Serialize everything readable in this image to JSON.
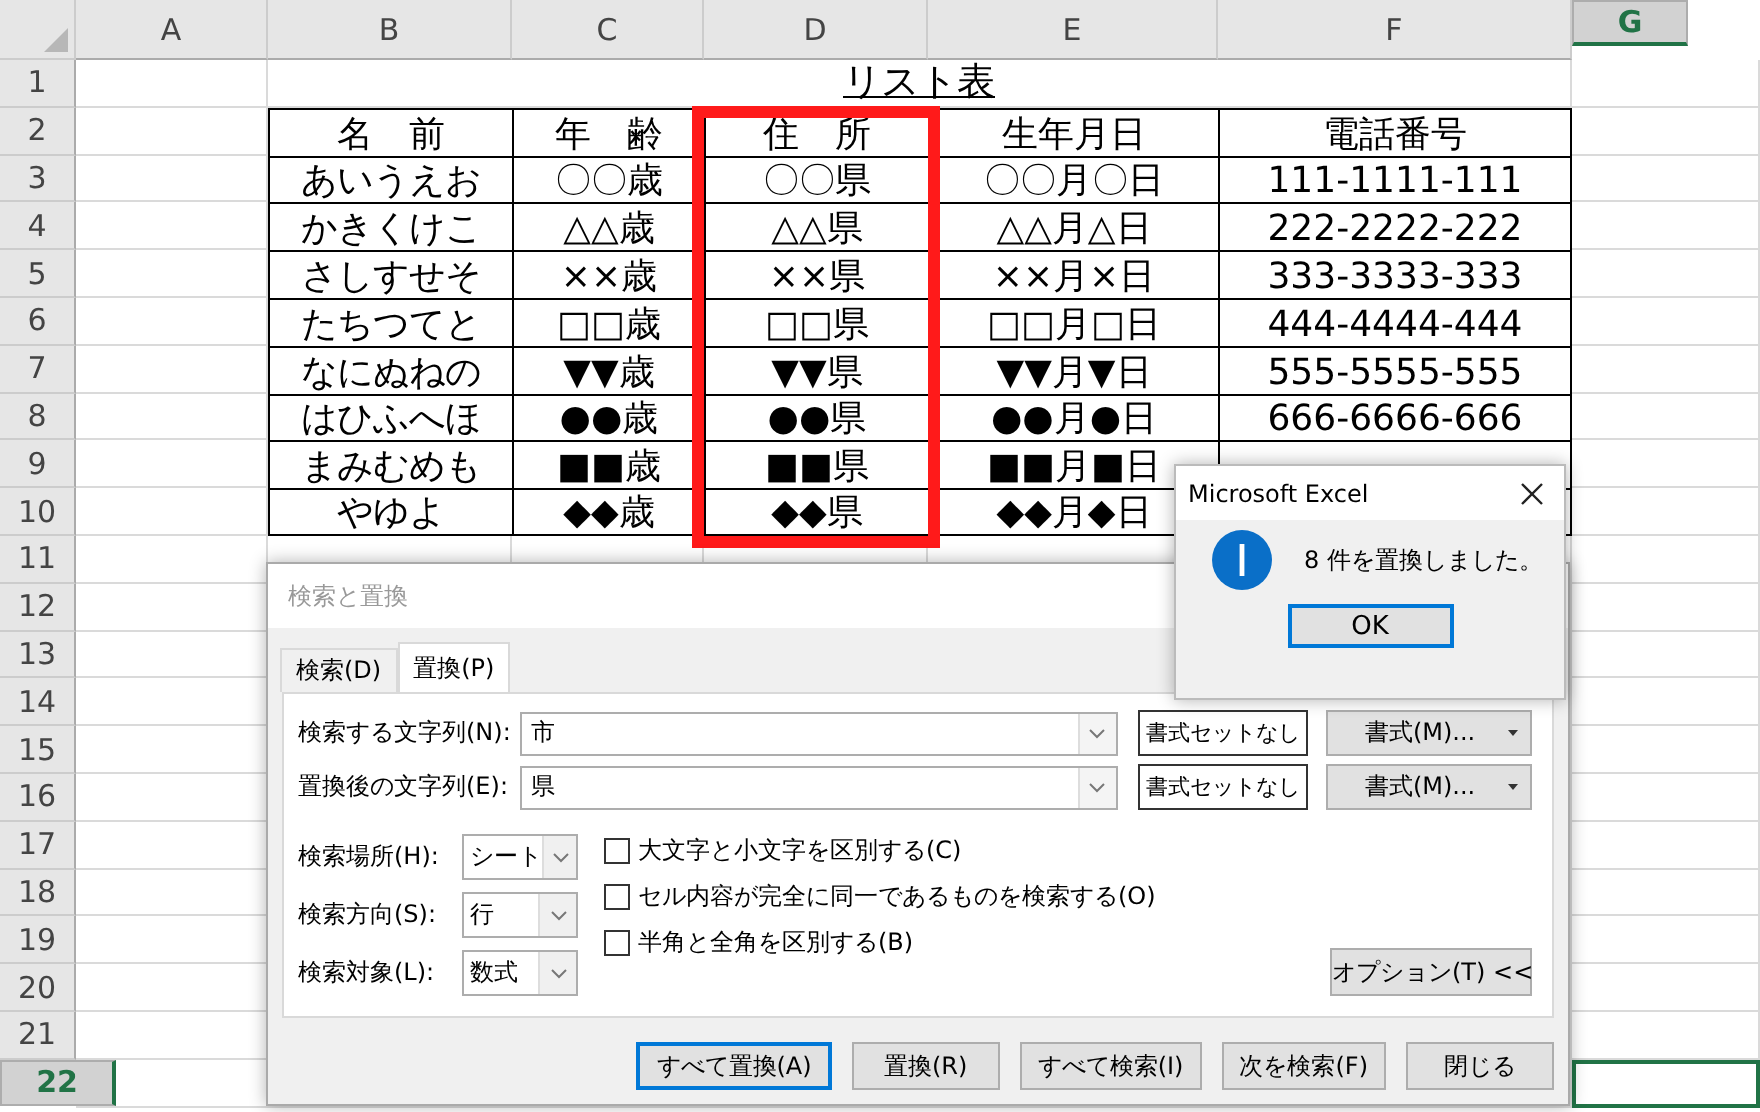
{
  "columns": [
    {
      "label": "A",
      "selected": false
    },
    {
      "label": "B",
      "selected": false
    },
    {
      "label": "C",
      "selected": false
    },
    {
      "label": "D",
      "selected": false
    },
    {
      "label": "E",
      "selected": false
    },
    {
      "label": "F",
      "selected": false
    },
    {
      "label": "G",
      "selected": true
    }
  ],
  "rows": [
    {
      "label": "1",
      "selected": false
    },
    {
      "label": "2",
      "selected": false
    },
    {
      "label": "3",
      "selected": false
    },
    {
      "label": "4",
      "selected": false
    },
    {
      "label": "5",
      "selected": false
    },
    {
      "label": "6",
      "selected": false
    },
    {
      "label": "7",
      "selected": false
    },
    {
      "label": "8",
      "selected": false
    },
    {
      "label": "9",
      "selected": false
    },
    {
      "label": "10",
      "selected": false
    },
    {
      "label": "11",
      "selected": false
    },
    {
      "label": "12",
      "selected": false
    },
    {
      "label": "13",
      "selected": false
    },
    {
      "label": "14",
      "selected": false
    },
    {
      "label": "15",
      "selected": false
    },
    {
      "label": "16",
      "selected": false
    },
    {
      "label": "17",
      "selected": false
    },
    {
      "label": "18",
      "selected": false
    },
    {
      "label": "19",
      "selected": false
    },
    {
      "label": "20",
      "selected": false
    },
    {
      "label": "21",
      "selected": false
    },
    {
      "label": "22",
      "selected": true
    }
  ],
  "sheet_title": "リスト表",
  "table": {
    "header": [
      {
        "text": "名　前",
        "highlighted": false
      },
      {
        "text": "年　齢",
        "highlighted": false
      },
      {
        "text": "住　所",
        "highlighted": true
      },
      {
        "text": "生年月日",
        "highlighted": false
      },
      {
        "text": "電話番号",
        "highlighted": false
      }
    ],
    "rows": [
      [
        "あいうえお",
        "〇〇歳",
        "〇〇県",
        "〇〇月〇日",
        "111-1111-111"
      ],
      [
        "かきくけこ",
        "△△歳",
        "△△県",
        "△△月△日",
        "222-2222-222"
      ],
      [
        "さしすせそ",
        "××歳",
        "××県",
        "××月×日",
        "333-3333-333"
      ],
      [
        "たちつてと",
        "□□歳",
        "□□県",
        "□□月□日",
        "444-4444-444"
      ],
      [
        "なにぬねの",
        "▼▼歳",
        "▼▼県",
        "▼▼月▼日",
        "555-5555-555"
      ],
      [
        "はひふへほ",
        "●●歳",
        "●●県",
        "●●月●日",
        "666-6666-666"
      ],
      [
        "まみむめも",
        "■■歳",
        "■■県",
        "■■月■日"
      ],
      [
        "やゆよ",
        "◆◆歳",
        "◆◆県",
        "◆◆月◆日"
      ]
    ]
  },
  "find_dialog": {
    "title": "検索と置換",
    "tabs": [
      {
        "label": "検索(D)",
        "selected": false
      },
      {
        "label": "置換(P)",
        "selected": true
      }
    ],
    "fields": [
      {
        "label": "検索する文字列(N):",
        "value": "市",
        "clear_button": "書式セットなし",
        "format_button": "書式(M)..."
      },
      {
        "label": "置換後の文字列(E):",
        "value": "県",
        "clear_button": "書式セットなし",
        "format_button": "書式(M)..."
      }
    ],
    "dropdowns": [
      {
        "label": "検索場所(H):",
        "value": "シート"
      },
      {
        "label": "検索方向(S):",
        "value": "行"
      },
      {
        "label": "検索対象(L):",
        "value": "数式"
      }
    ],
    "checkboxes": [
      {
        "label": "大文字と小文字を区別する(C)",
        "checked": false
      },
      {
        "label": "セル内容が完全に同一であるものを検索する(O)",
        "checked": false
      },
      {
        "label": "半角と全角を区別する(B)",
        "checked": false
      }
    ],
    "options_button": "オプション(T) <<",
    "buttons": [
      {
        "label": "すべて置換(A)",
        "default": true
      },
      {
        "label": "置換(R)",
        "default": false
      },
      {
        "label": "すべて検索(I)",
        "default": false
      },
      {
        "label": "次を検索(F)",
        "default": false
      },
      {
        "label": "閉じる",
        "default": false
      }
    ]
  },
  "message_box": {
    "title": "Microsoft Excel",
    "message": "8 件を置換しました。",
    "button": "OK"
  }
}
